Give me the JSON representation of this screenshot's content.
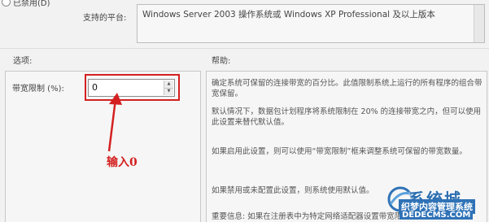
{
  "radio": {
    "label": "已禁用(D)"
  },
  "supported": {
    "label": "支持的平台:",
    "value": "Windows Server 2003 操作系统或 Windows XP Professional 及以上版本"
  },
  "options": {
    "heading": "选项:",
    "bandwidth_label": "带宽限制 (%):",
    "bandwidth_value": "0"
  },
  "help": {
    "heading": "帮助:",
    "paragraphs": [
      "确定系统可保留的连接带宽的百分比。此值限制系统上运行的所有程序的组合带宽保留。",
      "默认情况下，数据包计划程序将系统限制在 20% 的连接带宽之内，但可以使用此设置来替代默认值。",
      "如果启用此设置，则可以使用“带宽限制”框来调整系统可保留的带宽数量。",
      "如果禁用或未配置此设置，则系统使用默认值。",
      "重要信息: 如果在注册表中为特定网络适配器设置带宽限制"
    ]
  },
  "annotation": {
    "text": "输入0",
    "color": "#d42020"
  },
  "watermark": {
    "title": "系统城",
    "subtitle": "织梦内容管理系统",
    "url": "DEDECMS.COM"
  }
}
